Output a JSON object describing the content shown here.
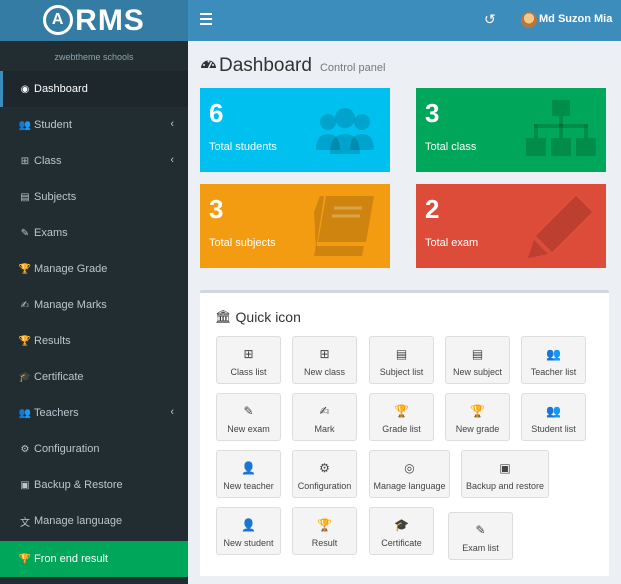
{
  "app": {
    "logo_text": "RMS",
    "logo_mark": "A"
  },
  "header": {
    "menu_icon": "hamburger-icon",
    "refresh_icon": "history-icon",
    "user_name": "Md Suzon Mia"
  },
  "sidebar": {
    "school_name": "zwebtheme schools",
    "items": [
      {
        "label": "Dashboard",
        "icon": "dashboard-icon",
        "chevron": false
      },
      {
        "label": "Student",
        "icon": "users-icon",
        "chevron": true
      },
      {
        "label": "Class",
        "icon": "sitemap-icon",
        "chevron": true
      },
      {
        "label": "Subjects",
        "icon": "book-icon",
        "chevron": false
      },
      {
        "label": "Exams",
        "icon": "pencil-icon",
        "chevron": false
      },
      {
        "label": "Manage Grade",
        "icon": "trophy-icon",
        "chevron": false
      },
      {
        "label": "Manage Marks",
        "icon": "edit-icon",
        "chevron": false
      },
      {
        "label": "Results",
        "icon": "trophy-icon",
        "chevron": false
      },
      {
        "label": "Certificate",
        "icon": "graduation-cap-icon",
        "chevron": false
      },
      {
        "label": "Teachers",
        "icon": "users-icon",
        "chevron": true
      },
      {
        "label": "Configuration",
        "icon": "gear-icon",
        "chevron": false
      },
      {
        "label": "Backup & Restore",
        "icon": "archive-icon",
        "chevron": false
      },
      {
        "label": "Manage language",
        "icon": "language-icon",
        "chevron": false
      }
    ],
    "bottom_item": {
      "label": "Fron end result",
      "icon": "trophy-icon"
    }
  },
  "page": {
    "title": "Dashboard",
    "subtitle": "Control panel"
  },
  "stats": [
    {
      "value": "6",
      "label": "Total students",
      "icon": "users-icon",
      "color": "#00c0ef"
    },
    {
      "value": "3",
      "label": "Total class",
      "icon": "sitemap-icon",
      "color": "#00a65a"
    },
    {
      "value": "3",
      "label": "Total subjects",
      "icon": "book-icon",
      "color": "#f39c12"
    },
    {
      "value": "2",
      "label": "Total exam",
      "icon": "pencil-icon",
      "color": "#dd4b39"
    }
  ],
  "quick": {
    "title": "Quick icon",
    "buttons": [
      {
        "label": "Class list",
        "icon": "sitemap-icon"
      },
      {
        "label": "New class",
        "icon": "sitemap-icon"
      },
      {
        "label": "Subject list",
        "icon": "book-icon"
      },
      {
        "label": "New subject",
        "icon": "book-icon"
      },
      {
        "label": "Teacher list",
        "icon": "users-icon"
      },
      {
        "label": "New exam",
        "icon": "pencil-icon"
      },
      {
        "label": "Mark",
        "icon": "edit-icon"
      },
      {
        "label": "Grade list",
        "icon": "trophy-icon"
      },
      {
        "label": "New grade",
        "icon": "trophy-icon"
      },
      {
        "label": "Student list",
        "icon": "users-icon"
      },
      {
        "label": "New teacher",
        "icon": "user-icon"
      },
      {
        "label": "Configuration",
        "icon": "gear-icon"
      },
      {
        "label": "Manage language",
        "icon": "life-ring-icon"
      },
      {
        "label": "Backup and restore",
        "icon": "archive-icon"
      },
      {
        "label": "New student",
        "icon": "user-icon"
      },
      {
        "label": "Result",
        "icon": "trophy-icon"
      },
      {
        "label": "Certificate",
        "icon": "graduation-cap-icon"
      },
      {
        "label": "Exam list",
        "icon": "pencil-icon"
      }
    ]
  }
}
